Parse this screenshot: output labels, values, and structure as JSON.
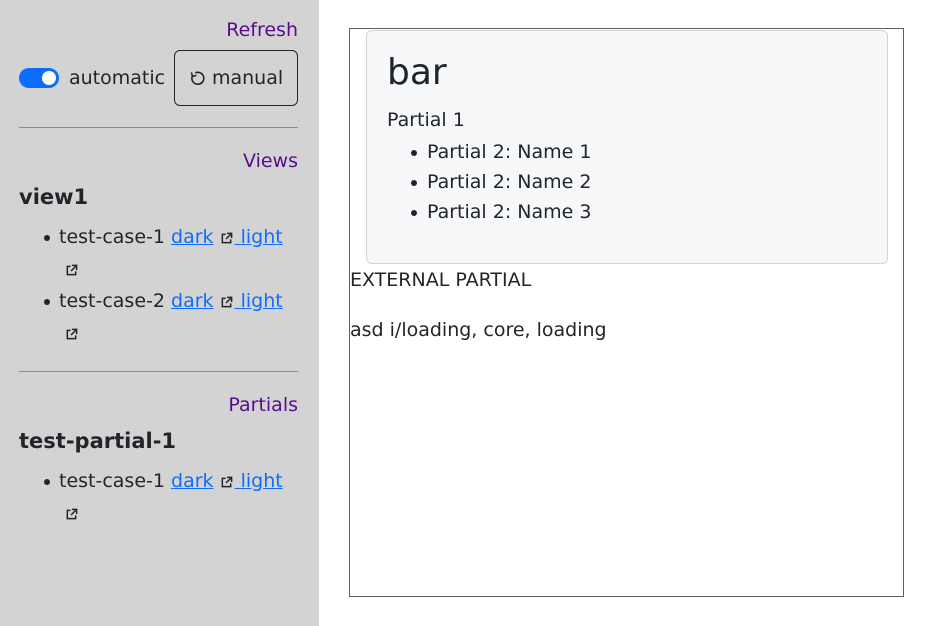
{
  "sidebar": {
    "refresh": {
      "heading": "Refresh",
      "toggle_label": "automatic",
      "toggle_on": true,
      "manual_label": "manual"
    },
    "views": {
      "heading": "Views",
      "groups": [
        {
          "title": "view1",
          "cases": [
            {
              "name": "test-case-1",
              "dark": "dark",
              "light": " light"
            },
            {
              "name": "test-case-2",
              "dark": "dark",
              "light": " light"
            }
          ]
        }
      ]
    },
    "partials": {
      "heading": "Partials",
      "groups": [
        {
          "title": "test-partial-1",
          "cases": [
            {
              "name": "test-case-1",
              "dark": "dark",
              "light": " light"
            }
          ]
        }
      ]
    }
  },
  "preview": {
    "title": "bar",
    "partial1": "Partial 1",
    "names": [
      "Partial 2: Name 1",
      "Partial 2: Name 2",
      "Partial 2: Name 3"
    ],
    "external": "EXTERNAL PARTIAL",
    "loading": "asd i/loading, core, loading"
  },
  "colors": {
    "sidebar_bg": "#d3d3d3",
    "heading": "#5a0a8c",
    "link": "#0d6efd",
    "toggle": "#0d6efd"
  },
  "icons": {
    "manual": "refresh-icon",
    "link": "external-link-icon"
  }
}
